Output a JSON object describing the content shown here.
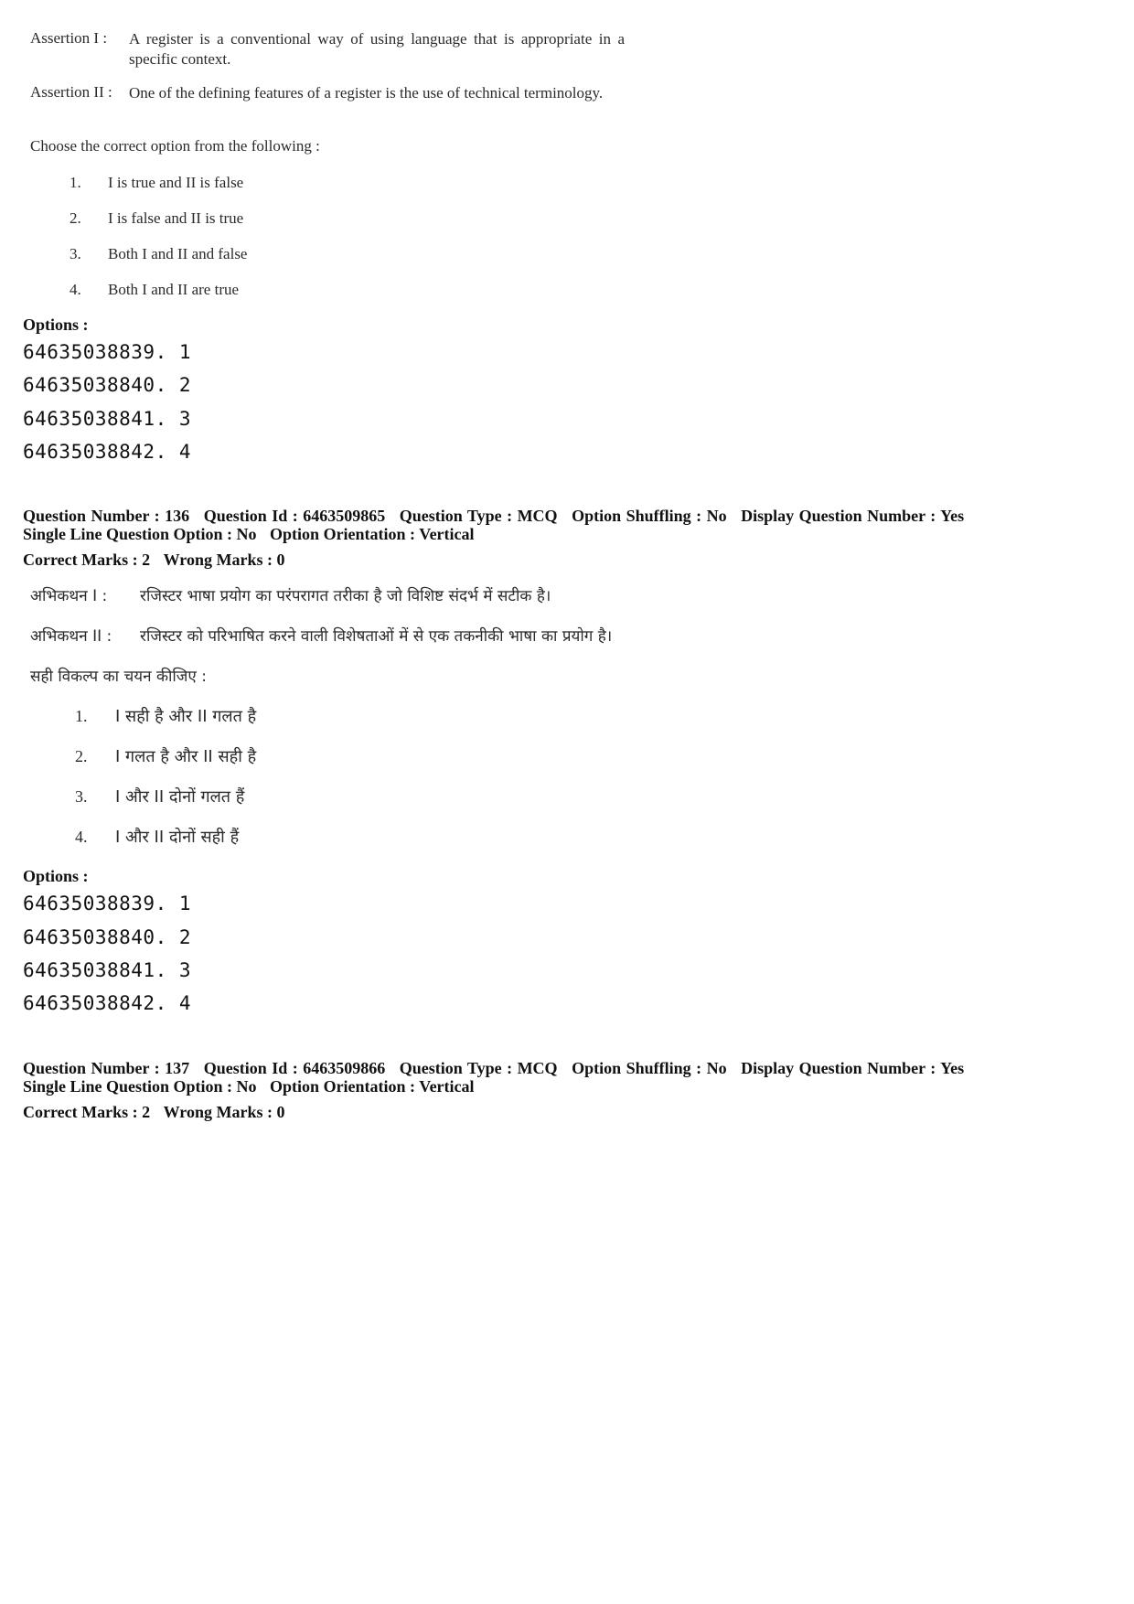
{
  "question_135": {
    "assertion_1_label": "Assertion  I :",
    "assertion_1_text": "A register is a conventional way of using language that is appropriate in a  specific context.",
    "assertion_2_label": "Assertion II :",
    "assertion_2_text": "One of the defining features of a register is the use of technical terminology.",
    "instruction": "Choose the correct option from the following  :",
    "choices": [
      {
        "num": "1.",
        "text": "I is true and II is false"
      },
      {
        "num": "2.",
        "text": "I is false and II is true"
      },
      {
        "num": "3.",
        "text": "Both I and II and false"
      },
      {
        "num": "4.",
        "text": "Both I and II are true"
      }
    ],
    "options_label": "Options :",
    "options": [
      "64635038839. 1",
      "64635038840. 2",
      "64635038841. 3",
      "64635038842. 4"
    ]
  },
  "question_136": {
    "meta_line_1": [
      "Question Number : 136",
      "Question Id : 6463509865",
      "Question Type : MCQ",
      "Option Shuffling : No",
      "Display Question Number : Yes"
    ],
    "meta_line_2": [
      "Single Line Question Option : No",
      "Option Orientation : Vertical"
    ],
    "marks": [
      "Correct Marks : 2",
      "Wrong Marks : 0"
    ],
    "assertion_1_label": "अभिकथन  I :",
    "assertion_1_text": "रजिस्टर भाषा प्रयोग का परंपरागत तरीका है जो विशिष्ट संदर्भ में सटीक है।",
    "assertion_2_label": "अभिकथन II :",
    "assertion_2_text": "रजिस्टर को परिभाषित करने वाली विशेषताओं में से एक तकनीकी भाषा का प्रयोग है।",
    "instruction": "सही विकल्प का चयन कीजिए :",
    "choices": [
      {
        "num": "1.",
        "text": "I सही है और II गलत है"
      },
      {
        "num": "2.",
        "text": "I  गलत है और II सही है"
      },
      {
        "num": "3.",
        "text": "I और II दोनों गलत हैं"
      },
      {
        "num": "4.",
        "text": "I और II दोनों सही हैं"
      }
    ],
    "options_label": "Options :",
    "options": [
      "64635038839. 1",
      "64635038840. 2",
      "64635038841. 3",
      "64635038842. 4"
    ]
  },
  "question_137": {
    "meta_line_1": [
      "Question Number : 137",
      "Question Id : 6463509866",
      "Question Type : MCQ",
      "Option Shuffling : No",
      "Display Question Number : Yes"
    ],
    "meta_line_2": [
      "Single Line Question Option : No",
      "Option Orientation : Vertical"
    ],
    "marks": [
      "Correct Marks : 2",
      "Wrong Marks : 0"
    ]
  }
}
